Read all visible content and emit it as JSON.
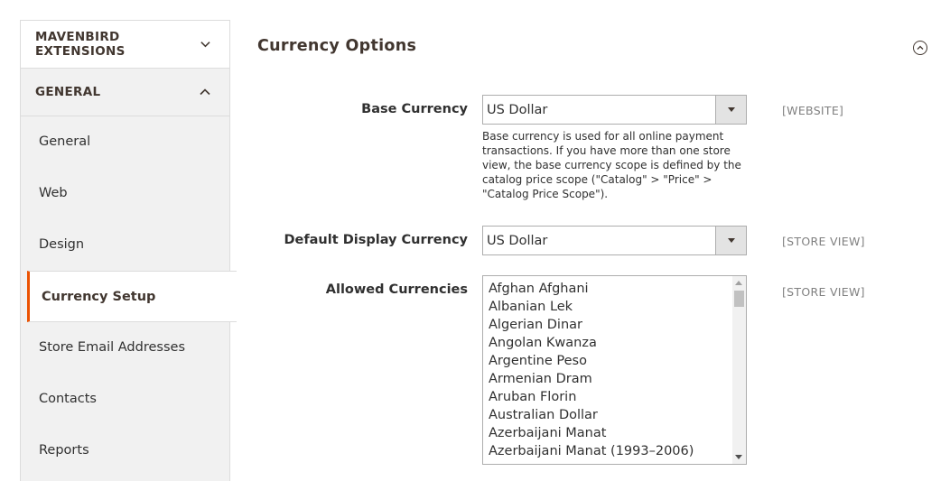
{
  "sidebar": {
    "extensions_label": "MAVENBIRD EXTENSIONS",
    "general_label": "GENERAL",
    "items": [
      {
        "label": "General"
      },
      {
        "label": "Web"
      },
      {
        "label": "Design"
      },
      {
        "label": "Currency Setup",
        "active": true
      },
      {
        "label": "Store Email Addresses"
      },
      {
        "label": "Contacts"
      },
      {
        "label": "Reports"
      }
    ]
  },
  "main": {
    "section_title": "Currency Options",
    "base_currency": {
      "label": "Base Currency",
      "value": "US Dollar",
      "scope": "[WEBSITE]",
      "note": "Base currency is used for all online payment transactions. If you have more than one store view, the base currency scope is defined by the catalog price scope (\"Catalog\" > \"Price\" > \"Catalog Price Scope\")."
    },
    "default_display_currency": {
      "label": "Default Display Currency",
      "value": "US Dollar",
      "scope": "[STORE VIEW]"
    },
    "allowed_currencies": {
      "label": "Allowed Currencies",
      "scope": "[STORE VIEW]",
      "options": [
        "Afghan Afghani",
        "Albanian Lek",
        "Algerian Dinar",
        "Angolan Kwanza",
        "Argentine Peso",
        "Armenian Dram",
        "Aruban Florin",
        "Australian Dollar",
        "Azerbaijani Manat",
        "Azerbaijani Manat (1993–2006)"
      ]
    }
  },
  "colors": {
    "accent": "#eb5202",
    "sidebar_bg": "#f1f1f1",
    "heading": "#41362f"
  },
  "icons": {
    "extensions_toggle": "chevron-down-icon",
    "general_toggle": "chevron-up-icon",
    "section_toggle": "collapse-circle-icon",
    "select_arrow": "caret-down-icon"
  }
}
